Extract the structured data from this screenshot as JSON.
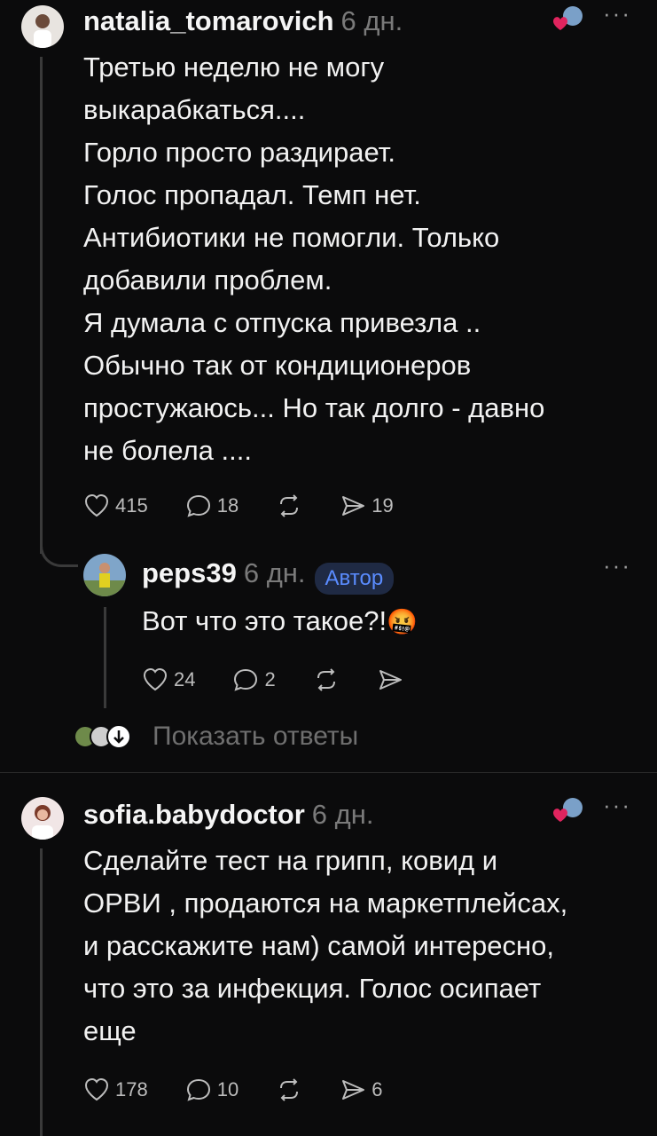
{
  "post1": {
    "username": "natalia_tomarovich",
    "time": "6 дн.",
    "lines": [
      "Третью неделю не могу",
      "выкарабкаться....",
      "Горло просто раздирает.",
      "Голос пропадал. Темп нет.",
      "Антибиотики не помогли. Только",
      "добавили проблем.",
      "Я думала с отпуска привезла ..",
      "Обычно так от  кондиционеров",
      "простужаюсь... Но так долго - давно",
      "не болела ...."
    ],
    "likes": "415",
    "comments": "18",
    "shares": "19"
  },
  "reply1": {
    "username": "peps39",
    "time": "6 дн.",
    "badge": "Автор",
    "text": "Вот что это такое?!",
    "emoji": "🤬",
    "likes": "24",
    "comments": "2"
  },
  "show_replies": {
    "label": "Показать ответы"
  },
  "post2": {
    "username": "sofia.babydoctor",
    "time": "6 дн.",
    "lines": [
      "Сделайте тест на грипп, ковид и",
      "ОРВИ , продаются на маркетплейсах,",
      "и расскажите нам) самой интересно,",
      "что это за инфекция. Голос осипает",
      "еще"
    ],
    "likes": "178",
    "comments": "10",
    "shares": "6"
  },
  "menu_glyph": "···",
  "colors": {
    "background": "#0b0b0c",
    "heart_red": "#e0245e",
    "badge_bg": "#1f2a44",
    "badge_text": "#5a8cff",
    "muted": "#7a7a7a"
  }
}
